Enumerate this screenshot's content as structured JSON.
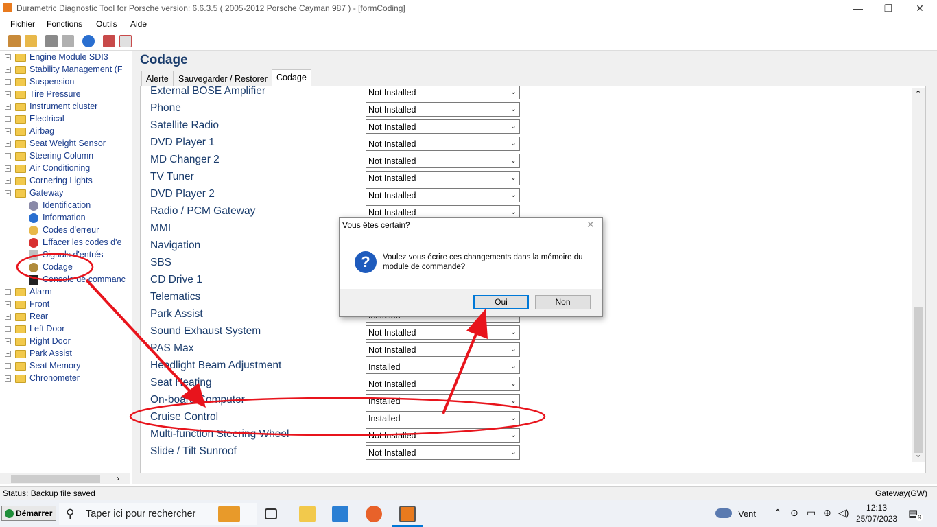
{
  "window": {
    "title": "Durametric Diagnostic Tool for Porsche version: 6.6.3.5  ( 2005-2012 Porsche Cayman 987 ) - [formCoding]",
    "minimize": "—",
    "restore": "❐",
    "close": "✕"
  },
  "menu": [
    "Fichier",
    "Fonctions",
    "Outils",
    "Aide"
  ],
  "tree": {
    "modules_top": [
      "Engine Module SDI3",
      "Stability Management (F",
      "Suspension",
      "Tire Pressure",
      "Instrument cluster",
      "Electrical",
      "Airbag",
      "Seat Weight Sensor",
      "Steering Column",
      "Air Conditioning",
      "Cornering Lights",
      "Gateway"
    ],
    "gateway_children": [
      "Identification",
      "Information",
      "Codes d'erreur",
      "Effacer les codes d'e",
      "Signals d'entrés",
      "Codage",
      "Console de commanc"
    ],
    "modules_bottom": [
      "Alarm",
      "Front",
      "Rear",
      "Left Door",
      "Right Door",
      "Park Assist",
      "Seat Memory",
      "Chronometer"
    ],
    "expander_plus": "+",
    "expander_minus": "−"
  },
  "page": {
    "title": "Codage",
    "tabs": [
      "Alerte",
      "Sauvegarder / Restorer",
      "Codage"
    ],
    "active_tab": "Codage"
  },
  "options": [
    {
      "label": "External BOSE Amplifier",
      "value": "Not Installed"
    },
    {
      "label": "Phone",
      "value": "Not Installed"
    },
    {
      "label": "Satellite Radio",
      "value": "Not Installed"
    },
    {
      "label": "DVD Player 1",
      "value": "Not Installed"
    },
    {
      "label": "MD Changer 2",
      "value": "Not Installed"
    },
    {
      "label": "TV Tuner",
      "value": "Not Installed"
    },
    {
      "label": "DVD Player 2",
      "value": "Not Installed"
    },
    {
      "label": "Radio / PCM Gateway",
      "value": "Not Installed"
    },
    {
      "label": "MMI",
      "value": ""
    },
    {
      "label": "Navigation",
      "value": ""
    },
    {
      "label": "SBS",
      "value": ""
    },
    {
      "label": "CD Drive 1",
      "value": ""
    },
    {
      "label": "Telematics",
      "value": ""
    },
    {
      "label": "Park Assist",
      "value": "Installed"
    },
    {
      "label": "Sound Exhaust System",
      "value": "Not Installed"
    },
    {
      "label": "PAS Max",
      "value": "Not Installed"
    },
    {
      "label": "Headlight Beam Adjustment",
      "value": "Installed"
    },
    {
      "label": "Seat Heating",
      "value": "Not Installed"
    },
    {
      "label": "On-board Computer",
      "value": "Installed"
    },
    {
      "label": "Cruise Control",
      "value": "Installed"
    },
    {
      "label": "Multi-function Steering Wheel",
      "value": "Not Installed"
    },
    {
      "label": "Slide / Tilt Sunroof",
      "value": "Not Installed"
    }
  ],
  "dialog": {
    "title": "Vous êtes certain?",
    "message": "Voulez vous écrire ces changements dans la mémoire du module de commande?",
    "icon": "?",
    "close": "✕",
    "yes": "Oui",
    "no": "Non"
  },
  "status": {
    "left": "Status: Backup file saved",
    "right": "Gateway(GW)"
  },
  "taskbar": {
    "start": "Démarrer",
    "search_placeholder": "Taper ici pour rechercher",
    "weather": "Vent",
    "time": "12:13",
    "date": "25/07/2023",
    "notifications": "9"
  },
  "colors": {
    "label_blue": "#1a3c6c",
    "tree_blue": "#1a3c8c",
    "annotation_red": "#e8141c",
    "dialog_accent": "#0078d7"
  }
}
